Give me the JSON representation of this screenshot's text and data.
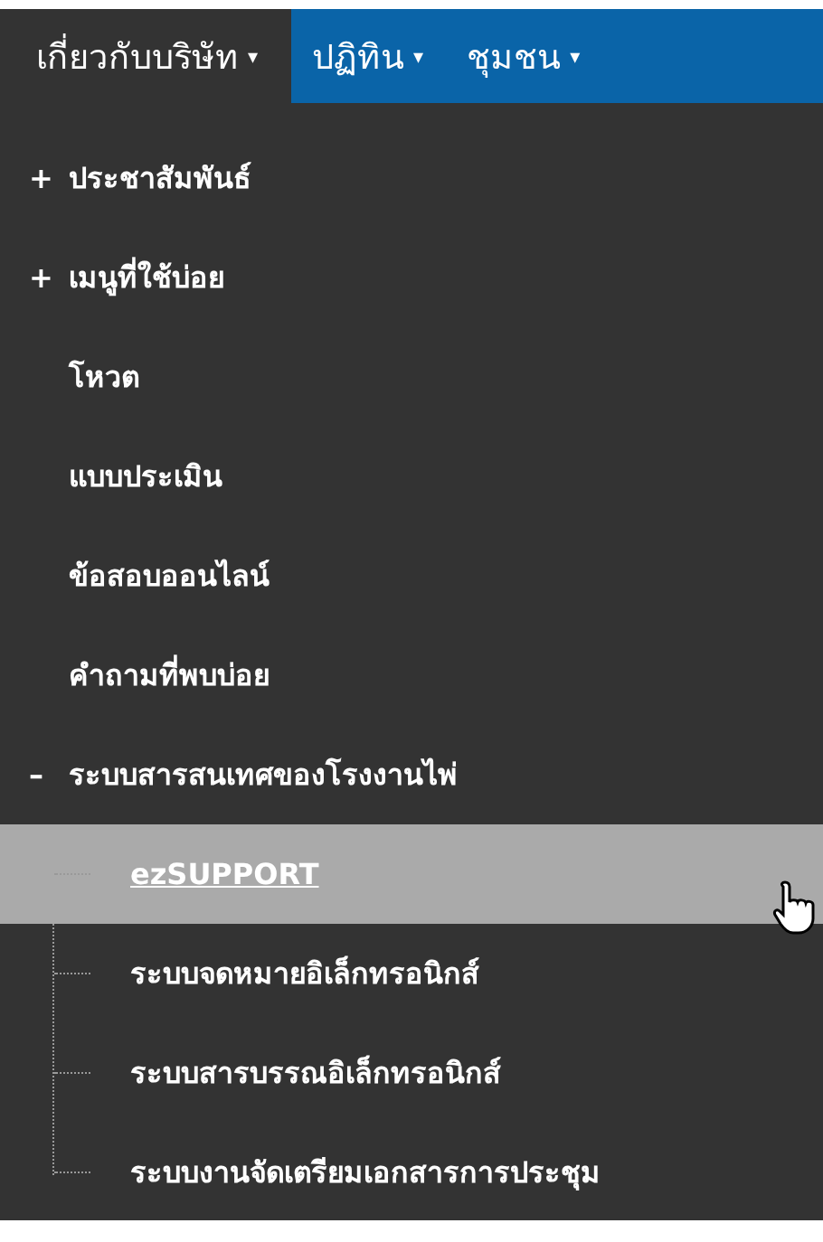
{
  "nav": [
    {
      "label": "เกี่ยวกับบริษัท",
      "caret": "▾",
      "selected": true
    },
    {
      "label": "ปฏิทิน",
      "caret": "▾",
      "selected": false
    },
    {
      "label": "ชุมชน",
      "caret": "▾",
      "selected": false
    }
  ],
  "menu": [
    {
      "marker": "+",
      "label": "ประชาสัมพันธ์"
    },
    {
      "marker": "+",
      "label": "เมนูที่ใช้บ่อย"
    },
    {
      "label": "โหวต"
    },
    {
      "label": "แบบประเมิน"
    },
    {
      "label": "ข้อสอบออนไลน์"
    },
    {
      "label": "คำถามที่พบบ่อย"
    },
    {
      "marker": "–",
      "label": "ระบบสารสนเทศของโรงงานไพ่",
      "expanded": true,
      "children": [
        {
          "label": "ezSUPPORT",
          "selected": true
        },
        {
          "label": "ระบบจดหมายอิเล็กทรอนิกส์",
          "selected": false
        },
        {
          "label": "ระบบสารบรรณอิเล็กทรอนิกส์",
          "selected": false
        },
        {
          "label": "ระบบงานจัดเตรียมเอกสารการประชุม",
          "selected": false
        }
      ]
    }
  ]
}
